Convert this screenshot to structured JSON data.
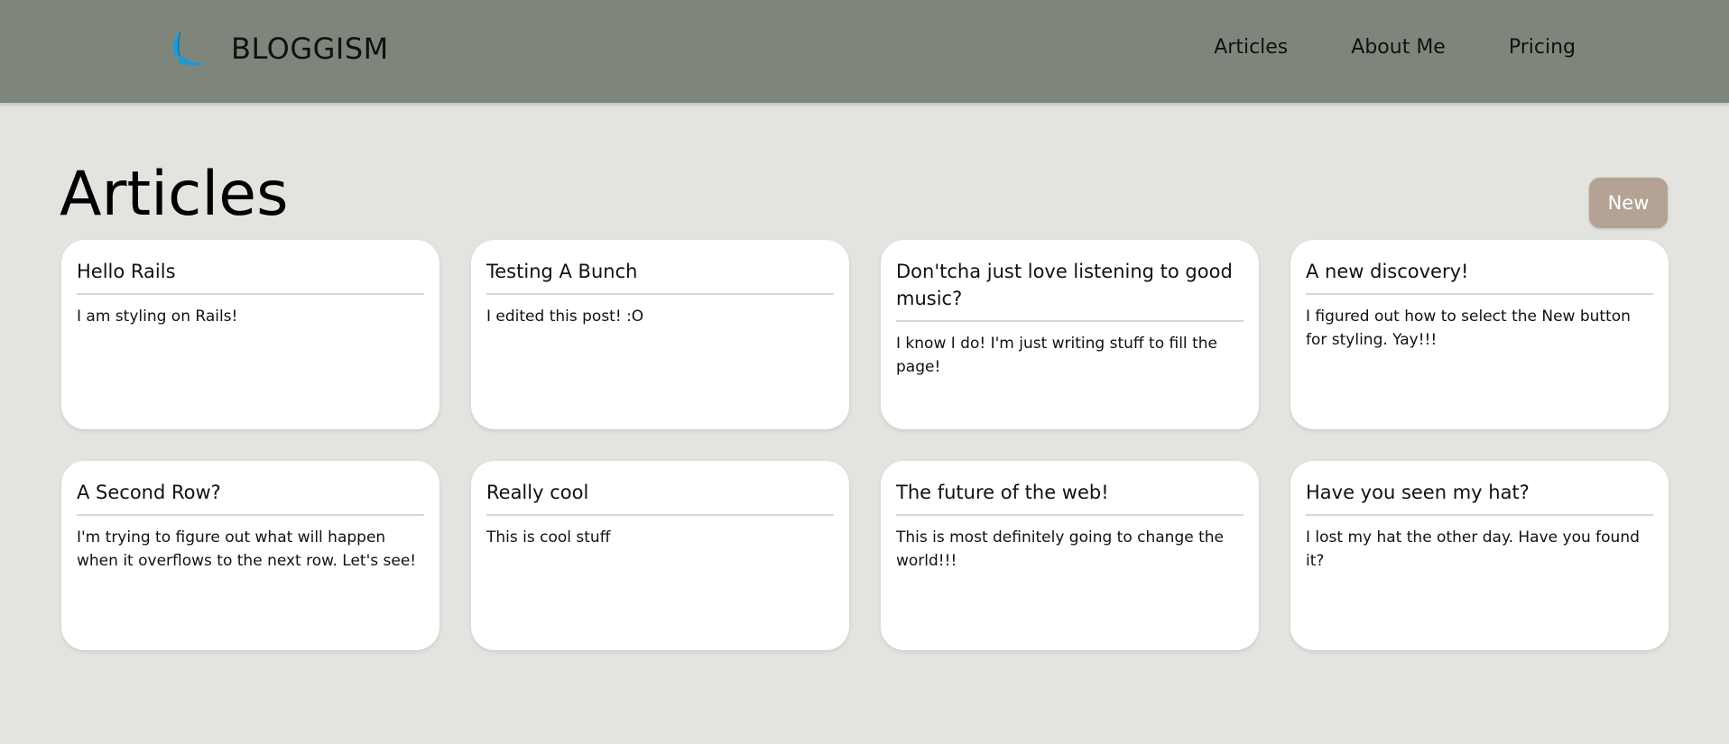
{
  "brand": {
    "name": "BLOGGISM",
    "logo_icon": "feather-quill-icon",
    "logo_color": "#1a9ad8"
  },
  "nav": {
    "items": [
      {
        "label": "Articles"
      },
      {
        "label": "About Me"
      },
      {
        "label": "Pricing"
      }
    ]
  },
  "page": {
    "title": "Articles",
    "new_button_label": "New"
  },
  "colors": {
    "navbar_bg": "#7e867c",
    "page_bg": "#e3e3df",
    "new_button_bg": "#b4a394",
    "card_bg": "#ffffff"
  },
  "articles": [
    {
      "title": "Hello Rails",
      "body": "I am styling on Rails!"
    },
    {
      "title": "Testing A Bunch",
      "body": "I edited this post! :O"
    },
    {
      "title": "Don'tcha just love listening to good music?",
      "body": "I know I do! I'm just writing stuff to fill the page!"
    },
    {
      "title": "A new discovery!",
      "body": "I figured out how to select the New button for styling. Yay!!!"
    },
    {
      "title": "A Second Row?",
      "body": "I'm trying to figure out what will happen when it overflows to the next row. Let's see!"
    },
    {
      "title": "Really cool",
      "body": "This is cool stuff"
    },
    {
      "title": "The future of the web!",
      "body": "This is most definitely going to change the world!!!"
    },
    {
      "title": "Have you seen my hat?",
      "body": "I lost my hat the other day. Have you found it?"
    }
  ]
}
